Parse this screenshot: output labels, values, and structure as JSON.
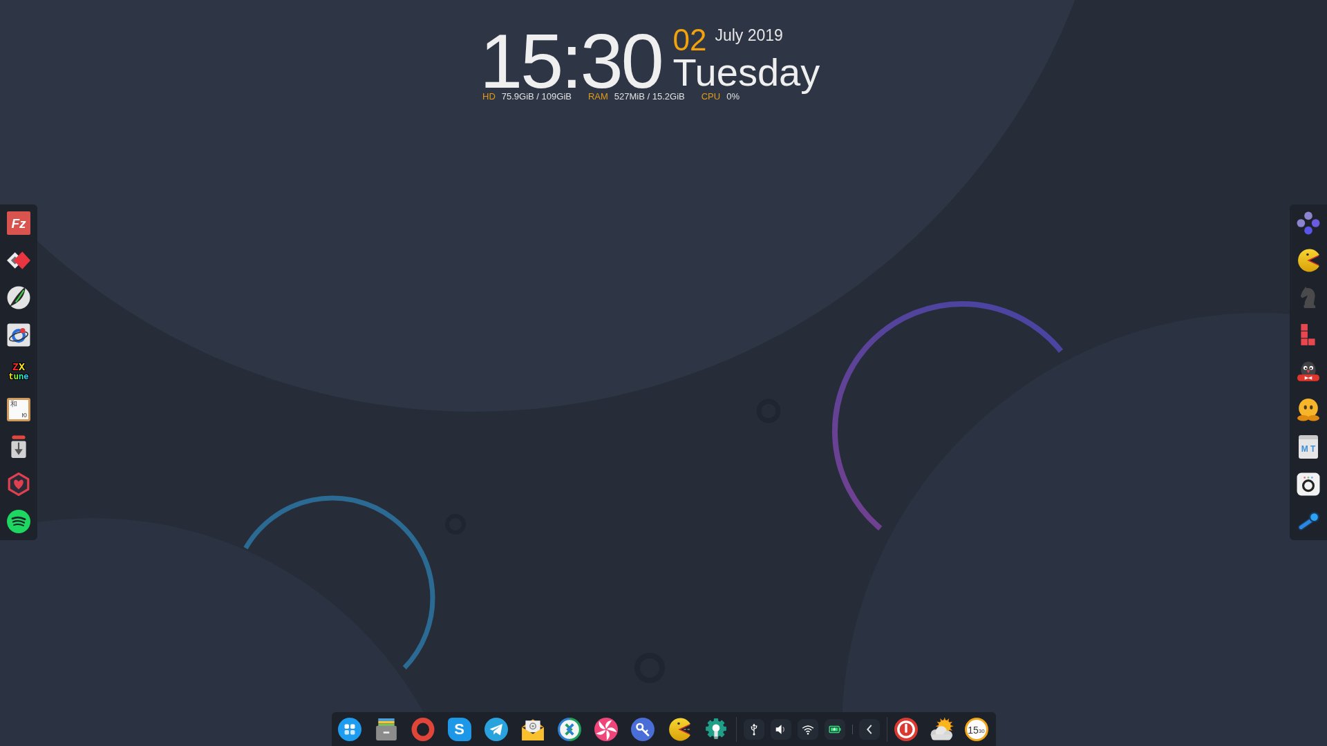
{
  "clock": {
    "time": "15:30",
    "day": "02",
    "month_year": "July 2019",
    "weekday": "Tuesday"
  },
  "stats": [
    {
      "label": "HD",
      "value": "75.9GiB / 109GiB"
    },
    {
      "label": "RAM",
      "value": "527MiB / 15.2GiB"
    },
    {
      "label": "CPU",
      "value": "0%"
    }
  ],
  "left_dock": [
    {
      "kind": "lettertile",
      "text": "Fz"
    },
    {
      "kind": "diamonds"
    },
    {
      "kind": "feather"
    },
    {
      "kind": "orbit"
    },
    {
      "kind": "pixeltext",
      "lines": [
        "ZX",
        "tune"
      ]
    },
    {
      "kind": "chartile",
      "lines": [
        "和",
        "ю"
      ]
    },
    {
      "kind": "download"
    },
    {
      "kind": "heart"
    },
    {
      "kind": "waves"
    }
  ],
  "right_dock": [
    {
      "kind": "dots"
    },
    {
      "kind": "pacman"
    },
    {
      "kind": "knight"
    },
    {
      "kind": "blocks"
    },
    {
      "kind": "mole"
    },
    {
      "kind": "blob"
    },
    {
      "kind": "carton",
      "text": "M T"
    },
    {
      "kind": "camera"
    },
    {
      "kind": "linkage"
    }
  ],
  "taskbar": {
    "apps": [
      {
        "kind": "grid"
      },
      {
        "kind": "drawer"
      },
      {
        "kind": "ring"
      },
      {
        "kind": "bubble",
        "text": "S"
      },
      {
        "kind": "plane"
      },
      {
        "kind": "mail"
      },
      {
        "kind": "arrows"
      },
      {
        "kind": "pinwheel"
      },
      {
        "kind": "key"
      },
      {
        "kind": "chomper"
      },
      {
        "kind": "gear"
      }
    ],
    "tray": [
      {
        "kind": "usb"
      },
      {
        "kind": "speaker"
      },
      {
        "kind": "wifi"
      },
      {
        "kind": "battery"
      }
    ],
    "status": [
      {
        "kind": "power"
      },
      {
        "kind": "weather"
      },
      {
        "kind": "clockface",
        "lines": [
          "15",
          "30"
        ]
      }
    ]
  }
}
